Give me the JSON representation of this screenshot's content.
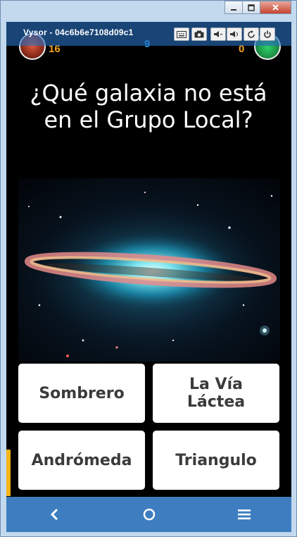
{
  "window": {
    "controls": [
      "minimize",
      "maximize",
      "close"
    ]
  },
  "vysor": {
    "title": "Vysor - 04c6b6e7108d09c1",
    "buttons": [
      "keyboard-icon",
      "camera-icon",
      "volume-down-icon",
      "volume-up-icon",
      "rotate-icon",
      "power-icon"
    ]
  },
  "scores": {
    "player_left": "16",
    "round": "9",
    "player_right": "0"
  },
  "question": {
    "text": "¿Qué galaxia no está en el Grupo Local?"
  },
  "answers": [
    {
      "label": "Sombrero"
    },
    {
      "label": "La Vía Láctea"
    },
    {
      "label": "Andrómeda"
    },
    {
      "label": "Triangulo"
    }
  ],
  "navbar": {
    "icons": [
      "back-icon",
      "home-icon",
      "menu-icon"
    ]
  },
  "colors": {
    "score_accent": "#f4a322",
    "round_accent": "#1e9be0",
    "navbar": "#3e7ec0",
    "timer": "#f4b41a"
  }
}
